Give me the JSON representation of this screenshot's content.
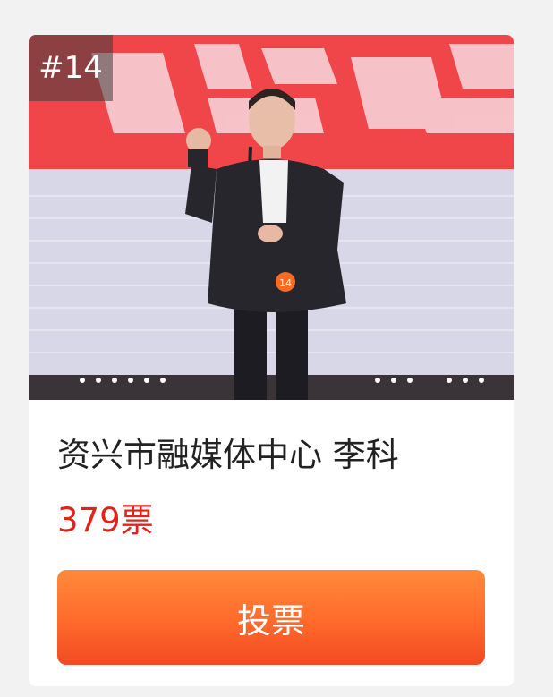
{
  "card": {
    "rank": "#14",
    "title": "资兴市融媒体中心 李科",
    "votes": "379票",
    "vote_button_label": "投票",
    "contestant_number_badge": "14"
  },
  "colors": {
    "votes_text": "#e0231b",
    "button_gradient_top": "#ff8a3a",
    "button_gradient_bottom": "#f24a23",
    "stage_banner": "#f0464a"
  }
}
